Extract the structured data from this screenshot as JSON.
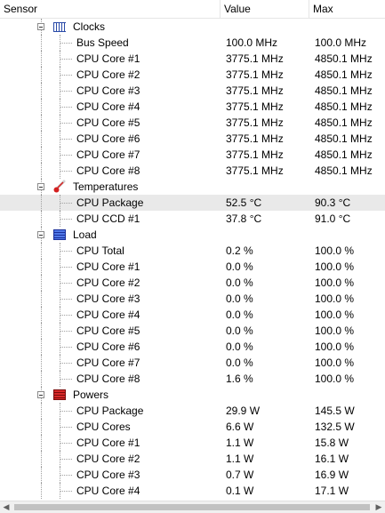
{
  "columns": {
    "sensor": "Sensor",
    "value": "Value",
    "max": "Max"
  },
  "groups": [
    {
      "label": "Clocks",
      "icon": "clock-icon",
      "sensors": [
        {
          "label": "Bus Speed",
          "value": "100.0 MHz",
          "max": "100.0 MHz"
        },
        {
          "label": "CPU Core #1",
          "value": "3775.1 MHz",
          "max": "4850.1 MHz"
        },
        {
          "label": "CPU Core #2",
          "value": "3775.1 MHz",
          "max": "4850.1 MHz"
        },
        {
          "label": "CPU Core #3",
          "value": "3775.1 MHz",
          "max": "4850.1 MHz"
        },
        {
          "label": "CPU Core #4",
          "value": "3775.1 MHz",
          "max": "4850.1 MHz"
        },
        {
          "label": "CPU Core #5",
          "value": "3775.1 MHz",
          "max": "4850.1 MHz"
        },
        {
          "label": "CPU Core #6",
          "value": "3775.1 MHz",
          "max": "4850.1 MHz"
        },
        {
          "label": "CPU Core #7",
          "value": "3775.1 MHz",
          "max": "4850.1 MHz"
        },
        {
          "label": "CPU Core #8",
          "value": "3775.1 MHz",
          "max": "4850.1 MHz"
        }
      ]
    },
    {
      "label": "Temperatures",
      "icon": "thermometer-icon",
      "sensors": [
        {
          "label": "CPU Package",
          "value": "52.5 °C",
          "max": "90.3 °C",
          "selected": true
        },
        {
          "label": "CPU CCD #1",
          "value": "37.8 °C",
          "max": "91.0 °C"
        }
      ]
    },
    {
      "label": "Load",
      "icon": "load-bars-icon",
      "sensors": [
        {
          "label": "CPU Total",
          "value": "0.2 %",
          "max": "100.0 %"
        },
        {
          "label": "CPU Core #1",
          "value": "0.0 %",
          "max": "100.0 %"
        },
        {
          "label": "CPU Core #2",
          "value": "0.0 %",
          "max": "100.0 %"
        },
        {
          "label": "CPU Core #3",
          "value": "0.0 %",
          "max": "100.0 %"
        },
        {
          "label": "CPU Core #4",
          "value": "0.0 %",
          "max": "100.0 %"
        },
        {
          "label": "CPU Core #5",
          "value": "0.0 %",
          "max": "100.0 %"
        },
        {
          "label": "CPU Core #6",
          "value": "0.0 %",
          "max": "100.0 %"
        },
        {
          "label": "CPU Core #7",
          "value": "0.0 %",
          "max": "100.0 %"
        },
        {
          "label": "CPU Core #8",
          "value": "1.6 %",
          "max": "100.0 %"
        }
      ]
    },
    {
      "label": "Powers",
      "icon": "power-bars-icon",
      "sensors": [
        {
          "label": "CPU Package",
          "value": "29.9 W",
          "max": "145.5 W"
        },
        {
          "label": "CPU Cores",
          "value": "6.6 W",
          "max": "132.5 W"
        },
        {
          "label": "CPU Core #1",
          "value": "1.1 W",
          "max": "15.8 W"
        },
        {
          "label": "CPU Core #2",
          "value": "1.1 W",
          "max": "16.1 W"
        },
        {
          "label": "CPU Core #3",
          "value": "0.7 W",
          "max": "16.9 W"
        },
        {
          "label": "CPU Core #4",
          "value": "0.1 W",
          "max": "17.1 W"
        }
      ]
    }
  ],
  "colors": {
    "selected_row": "#e9e9e9",
    "clock_icon": "#2a4aa8",
    "thermometer_icon": "#d42020",
    "load_icon": "#2040c0",
    "power_icon": "#b01818"
  }
}
